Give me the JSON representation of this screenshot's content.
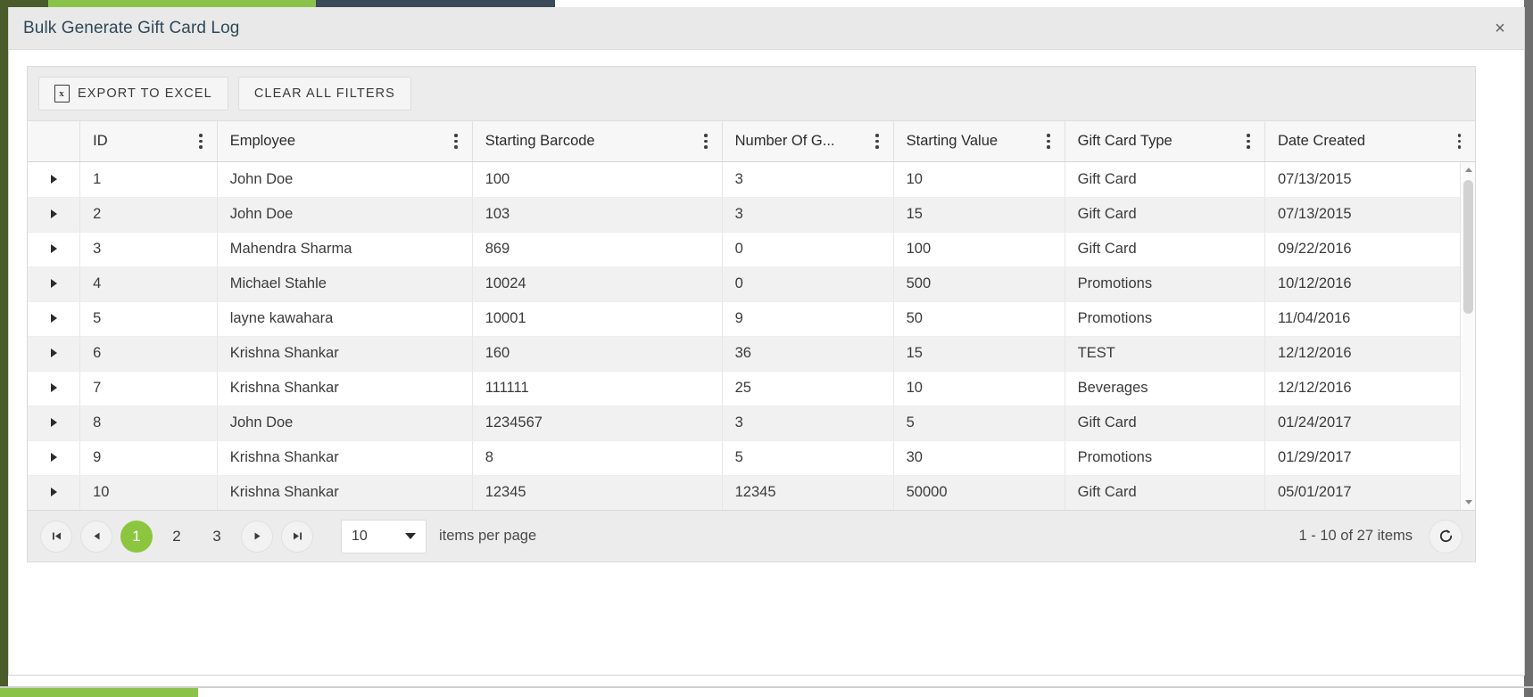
{
  "window": {
    "title": "Bulk Generate Gift Card Log",
    "close_icon": "close-icon",
    "close_glyph": "×"
  },
  "toolbar": {
    "export_label": "EXPORT TO EXCEL",
    "export_icon_glyph": "x",
    "clear_filters_label": "CLEAR ALL FILTERS"
  },
  "grid": {
    "columns": [
      {
        "key": "expand",
        "label": "",
        "menu": false
      },
      {
        "key": "id",
        "label": "ID",
        "menu": true
      },
      {
        "key": "employee",
        "label": "Employee",
        "menu": true
      },
      {
        "key": "starting_barcode",
        "label": "Starting Barcode",
        "menu": true
      },
      {
        "key": "number_of_g",
        "label": "Number Of G...",
        "menu": true
      },
      {
        "key": "starting_value",
        "label": "Starting Value",
        "menu": true
      },
      {
        "key": "gift_card_type",
        "label": "Gift Card Type",
        "menu": true
      },
      {
        "key": "date_created",
        "label": "Date Created",
        "menu": true
      }
    ],
    "rows": [
      {
        "id": "1",
        "employee": "John Doe",
        "starting_barcode": "100",
        "number_of_g": "3",
        "starting_value": "10",
        "gift_card_type": "Gift Card",
        "date_created": "07/13/2015"
      },
      {
        "id": "2",
        "employee": "John Doe",
        "starting_barcode": "103",
        "number_of_g": "3",
        "starting_value": "15",
        "gift_card_type": "Gift Card",
        "date_created": "07/13/2015"
      },
      {
        "id": "3",
        "employee": "Mahendra Sharma",
        "starting_barcode": "869",
        "number_of_g": "0",
        "starting_value": "100",
        "gift_card_type": "Gift Card",
        "date_created": "09/22/2016"
      },
      {
        "id": "4",
        "employee": "Michael Stahle",
        "starting_barcode": "10024",
        "number_of_g": "0",
        "starting_value": "500",
        "gift_card_type": "Promotions",
        "date_created": "10/12/2016"
      },
      {
        "id": "5",
        "employee": "layne kawahara",
        "starting_barcode": "10001",
        "number_of_g": "9",
        "starting_value": "50",
        "gift_card_type": "Promotions",
        "date_created": "11/04/2016"
      },
      {
        "id": "6",
        "employee": "Krishna Shankar",
        "starting_barcode": "160",
        "number_of_g": "36",
        "starting_value": "15",
        "gift_card_type": "TEST",
        "date_created": "12/12/2016"
      },
      {
        "id": "7",
        "employee": "Krishna Shankar",
        "starting_barcode": "111111",
        "number_of_g": "25",
        "starting_value": "10",
        "gift_card_type": "Beverages",
        "date_created": "12/12/2016"
      },
      {
        "id": "8",
        "employee": "John Doe",
        "starting_barcode": "1234567",
        "number_of_g": "3",
        "starting_value": "5",
        "gift_card_type": "Gift Card",
        "date_created": "01/24/2017"
      },
      {
        "id": "9",
        "employee": "Krishna Shankar",
        "starting_barcode": "8",
        "number_of_g": "5",
        "starting_value": "30",
        "gift_card_type": "Promotions",
        "date_created": "01/29/2017"
      },
      {
        "id": "10",
        "employee": "Krishna Shankar",
        "starting_barcode": "12345",
        "number_of_g": "12345",
        "starting_value": "50000",
        "gift_card_type": "Gift Card",
        "date_created": "05/01/2017"
      }
    ]
  },
  "pager": {
    "first_glyph": "❙◀",
    "prev_glyph": "◀",
    "next_glyph": "▶",
    "last_glyph": "▶❙",
    "pages": [
      "1",
      "2",
      "3"
    ],
    "active_page": "1",
    "page_size": "10",
    "page_size_label": "items per page",
    "info": "1 - 10 of 27 items",
    "refresh_icon": "refresh-icon"
  },
  "colors": {
    "accent_green": "#8cc63f",
    "title_text": "#2f4858",
    "header_bg": "#f7f7f7",
    "alt_row_bg": "#f1f1f1",
    "toolbar_bg": "#ececec"
  }
}
